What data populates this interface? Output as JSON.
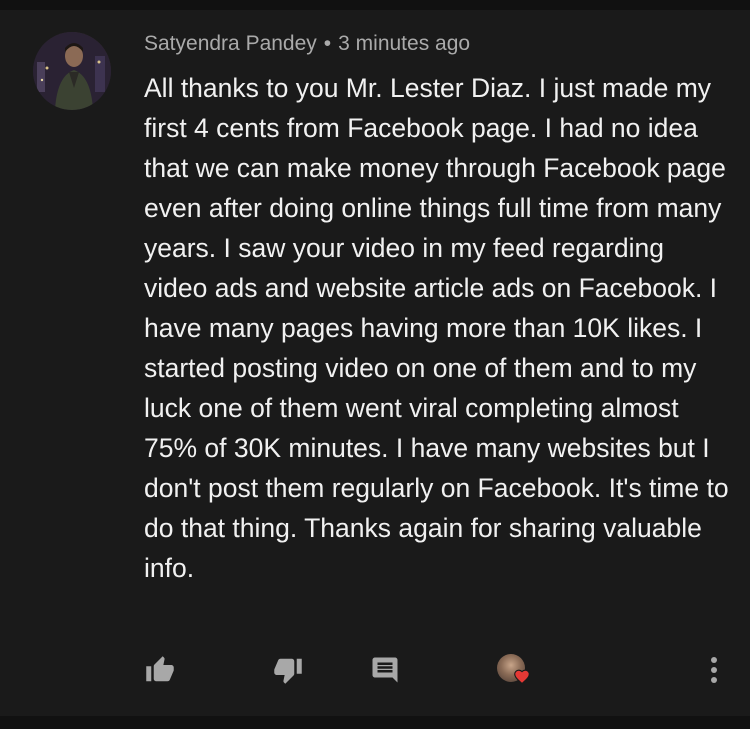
{
  "comment": {
    "author": "Satyendra Pandey",
    "separator": "•",
    "timestamp": "3 minutes ago",
    "text": "All thanks to you Mr. Lester Diaz. I just made my first 4 cents from Facebook page. I had no idea that we can make money through Facebook page even after doing online things full time from many years. I saw your video in my feed regarding video ads and website article ads on Facebook. I have many pages having more than 10K likes. I started posting video on one of them and to my luck one of them went viral completing almost 75% of 30K minutes. I have many websites but I don't post them regularly on Facebook. It's time to do that thing. Thanks again for sharing valuable info."
  },
  "actions": {
    "like_icon": "thumbs-up-icon",
    "dislike_icon": "thumbs-down-icon",
    "reply_icon": "comment-icon",
    "creator_heart_icon": "creator-heart-icon",
    "more_icon": "more-vertical-icon"
  },
  "colors": {
    "background": "#1a1a1a",
    "text": "#f1f1f1",
    "meta": "#aaaaaa",
    "icon": "#a8a8a8",
    "heart": "#e53935"
  }
}
